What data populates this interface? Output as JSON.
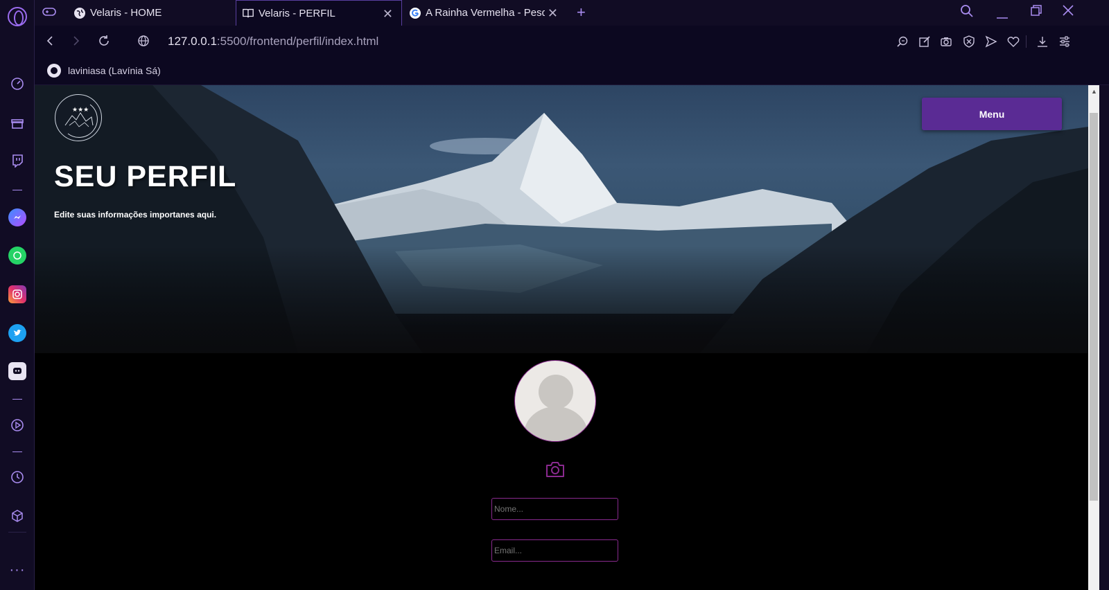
{
  "browser": {
    "tabs": [
      {
        "label": "Velaris - HOME",
        "icon": "globe-icon"
      },
      {
        "label": "Velaris - PERFIL",
        "icon": "book-icon",
        "active": true
      },
      {
        "label": "A Rainha Vermelha - Pesqu",
        "icon": "google-icon"
      }
    ],
    "url_host": "127.0.0.1",
    "url_path": ":5500/frontend/perfil/index.html",
    "bookmark": "laviniasa (Lavínia Sá)",
    "accent": "#9b6cf0"
  },
  "sidebar_icons": [
    "speed-dial-icon",
    "gift-icon",
    "twitch-icon",
    "messenger-icon",
    "whatsapp-icon",
    "instagram-icon",
    "twitter-icon",
    "discord-icon",
    "player-icon",
    "history-icon",
    "cube-icon",
    "more-icon"
  ],
  "page": {
    "title": "SEU PERFIL",
    "subtitle": "Edite suas informações importanes aqui.",
    "menu_label": "Menu",
    "name_placeholder": "Nome...",
    "email_placeholder": "Email...",
    "menu_color": "#5a2b94",
    "field_border": "#8a2a8f"
  }
}
